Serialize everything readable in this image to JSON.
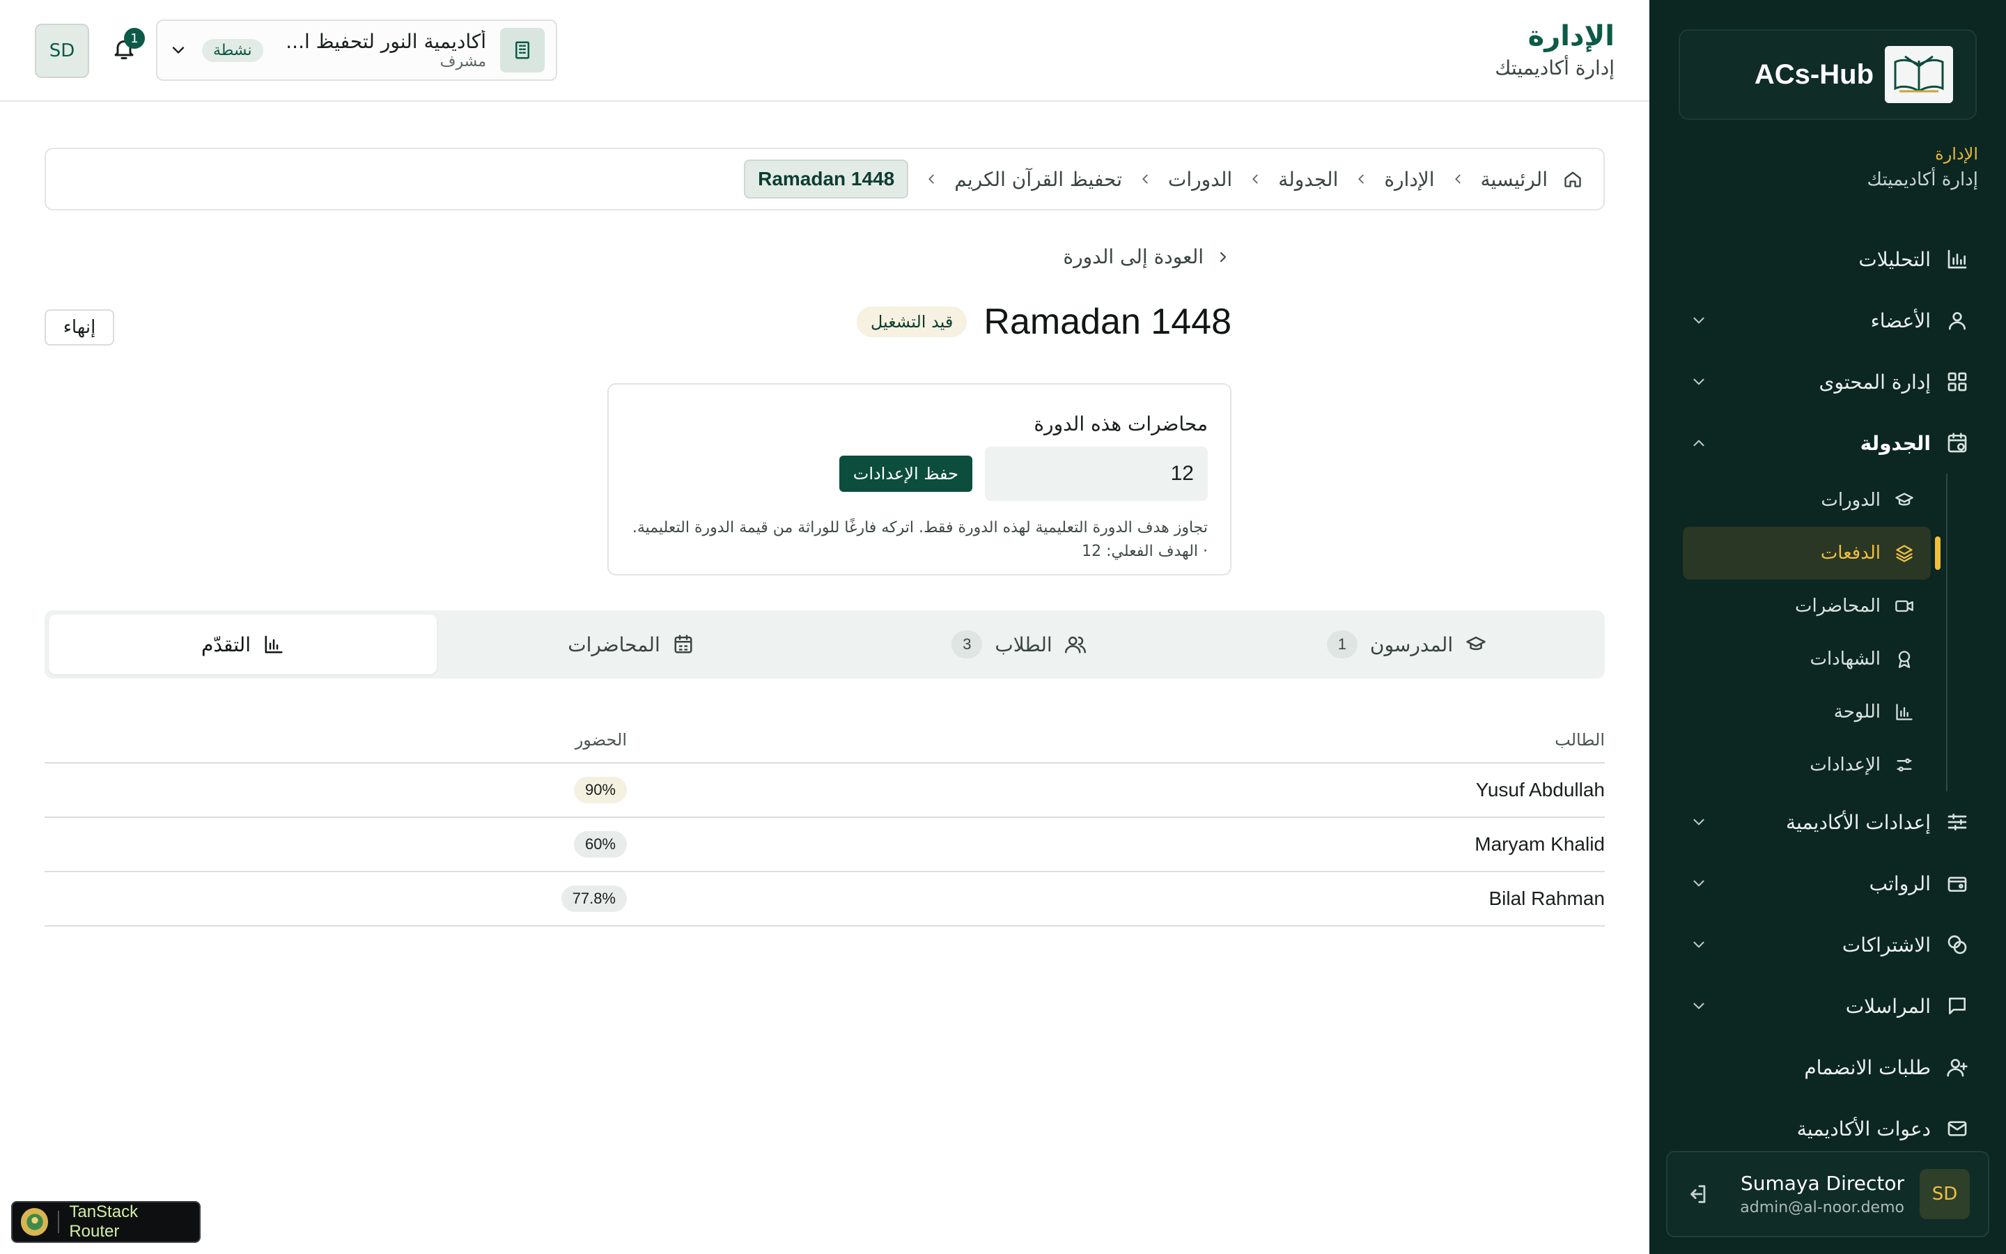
{
  "sidebar": {
    "brand": "ACs-Hub",
    "section_title": "الإدارة",
    "section_subtitle": "إدارة أكاديميتك",
    "nav": {
      "analytics": "التحليلات",
      "members": "الأعضاء",
      "content": "إدارة المحتوى",
      "schedule": "الجدولة",
      "academy_settings": "إعدادات الأكاديمية",
      "salaries": "الرواتب",
      "subscriptions": "الاشتراكات",
      "messages": "المراسلات",
      "join_requests": "طلبات الانضمام",
      "invitations": "دعوات الأكاديمية"
    },
    "schedule_sub": {
      "courses": "الدورات",
      "batches": "الدفعات",
      "lectures": "المحاضرات",
      "certificates": "الشهادات",
      "board": "اللوحة",
      "settings": "الإعدادات"
    },
    "user": {
      "initials": "SD",
      "name": "Sumaya Director",
      "email": "admin@al-noor.demo"
    }
  },
  "header": {
    "title": "الإدارة",
    "subtitle": "إدارة أكاديميتك",
    "org_name": "أكاديمية النور لتحفيظ ا...",
    "org_role": "مشرف",
    "org_status": "نشطة",
    "notifications": "1",
    "avatar": "SD"
  },
  "breadcrumb": {
    "home": "الرئيسية",
    "admin": "الإدارة",
    "schedule": "الجدولة",
    "courses": "الدورات",
    "course": "تحفيظ القرآن الكريم",
    "current": "Ramadan 1448"
  },
  "back_label": "العودة إلى الدورة",
  "batch": {
    "name": "Ramadan 1448",
    "status": "قيد التشغيل",
    "end_label": "إنهاء"
  },
  "lectures_card": {
    "label": "محاضرات هذه الدورة",
    "value": "12",
    "save_label": "حفظ الإعدادات",
    "help": "تجاوز هدف الدورة التعليمية لهذه الدورة فقط. اتركه فارغًا للوراثة من قيمة الدورة التعليمية. · الهدف الفعلي: 12"
  },
  "tabs": {
    "teachers": "المدرسون",
    "teachers_count": "1",
    "students": "الطلاب",
    "students_count": "3",
    "lectures": "المحاضرات",
    "progress": "التقدّم"
  },
  "table": {
    "headers": {
      "student": "الطالب",
      "attendance": "الحضور"
    },
    "rows": [
      {
        "student": "Yusuf Abdullah",
        "attendance": "90%"
      },
      {
        "student": "Maryam Khalid",
        "attendance": "60%"
      },
      {
        "student": "Bilal Rahman",
        "attendance": "77.8%"
      }
    ]
  },
  "devtools": {
    "label": "TanStack Router"
  }
}
